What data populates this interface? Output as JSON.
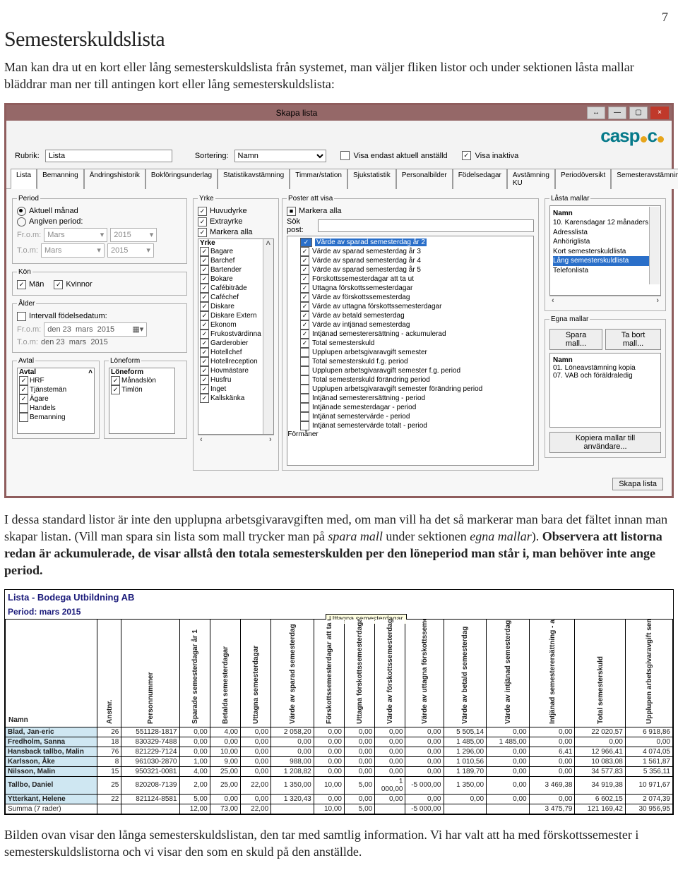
{
  "page_number": "7",
  "doc": {
    "heading": "Semesterskuldslista",
    "intro": "Man kan dra ut en kort eller lång semesterskuldslista från systemet, man väljer fliken listor och under sektionen låsta mallar bläddrar man ner till antingen kort eller lång semesterskuldslista:",
    "mid_a": "I dessa standard listor är inte den upplupna arbetsgivaravgiften med, om man vill ha det så markerar man bara det fältet innan man skapar listan. (Vill man spara sin lista som mall trycker man på ",
    "mid_em1": "spara mall",
    "mid_b": " under sektionen ",
    "mid_em2": "egna mallar",
    "mid_c": "). ",
    "mid_strong": "Observera att listorna redan är ackumulerade, de visar allstå den totala semesterskulden per den löneperiod man står i, man behöver inte ange period.",
    "bottom": "Bilden ovan visar den långa semesterskuldslistan, den tar med samtlig information. Vi har valt att ha med förskottssemester i semesterskuldslistorna och vi visar den som en skuld på den anställde."
  },
  "dialog": {
    "title": "Skapa lista",
    "logo": "caspeco",
    "rubrik_label": "Rubrik:",
    "rubrik_value": "Lista",
    "sortering_label": "Sortering:",
    "sortering_value": "Namn",
    "chk_aktuell": "Visa endast aktuell anställd",
    "chk_inaktiva": "Visa inaktiva",
    "tabs": [
      "Lista",
      "Bemanning",
      "Ändringshistorik",
      "Bokföringsunderlag",
      "Statistikavstämning",
      "Timmar/station",
      "Sjukstatistik",
      "Personalbilder",
      "Födelsedagar",
      "Avstämning KU",
      "Periodöversikt",
      "Semesteravstämning"
    ],
    "period": {
      "legend": "Period",
      "opt_aktuell": "Aktuell månad",
      "opt_angiven": "Angiven period:",
      "from_label": "Fr.o.m:",
      "to_label": "T.o.m:",
      "month": "Mars",
      "year": "2015"
    },
    "kon": {
      "legend": "Kön",
      "man": "Män",
      "kvinnor": "Kvinnor"
    },
    "alder": {
      "legend": "Ålder",
      "intervall": "Intervall födelsedatum:",
      "from_label": "Fr.o.m:",
      "to_label": "T.o.m:",
      "day": "den 23",
      "month": "mars",
      "year": "2015"
    },
    "avtal": {
      "legend": "Avtal",
      "header": "Avtal",
      "items": [
        "HRF",
        "Tjänstemän",
        "Ägare",
        "Handels",
        "Bemanning"
      ]
    },
    "loneform": {
      "legend": "Löneform",
      "header": "Löneform",
      "items": [
        "Månadslön",
        "Timlön"
      ]
    },
    "yrke": {
      "legend": "Yrke",
      "huvud": "Huvudyrke",
      "extra": "Extrayrke",
      "markall": "Markera alla",
      "listhead": "Yrke",
      "items": [
        "Bagare",
        "Barchef",
        "Bartender",
        "Bokare",
        "Cafébiträde",
        "Caféchef",
        "Diskare",
        "Diskare Extern",
        "Ekonom",
        "Frukostvärdinna",
        "Garderobier",
        "Hotellchef",
        "Hotellreception",
        "Hovmästare",
        "Husfru",
        "Inget",
        "Kallskänka"
      ]
    },
    "poster": {
      "legend": "Poster att visa",
      "markall": "Markera alla",
      "sok": "Sök post:",
      "selected": "Värde av sparad semesterdag år 2",
      "items_checked": [
        "Värde av sparad semesterdag år 3",
        "Värde av sparad semesterdag år 4",
        "Värde av sparad semesterdag år 5",
        "Förskottssemesterdagar att ta ut",
        "Uttagna förskottssemesterdagar",
        "Värde av förskottssemesterdag",
        "Värde av uttagna förskottssemesterdagar",
        "Värde av betald semesterdag",
        "Värde av intjänad semesterdag",
        "Intjänad semesterersättning - ackumulerad",
        "Total semesterskuld"
      ],
      "items_unchecked": [
        "Upplupen arbetsgivaravgift semester",
        "Total semesterskuld f.g. period",
        "Upplupen arbetsgivaravgift semester f.g. period",
        "Total semesterskuld förändring period",
        "Upplupen arbetsgivaravgift semester förändring period",
        "Intjänad semesterersättning - period",
        "Intjänade semesterdagar - period",
        "Intjänat semestervärde - period",
        "Intjänat semestervärde totalt - period"
      ],
      "branch": "Förmåner"
    },
    "lasta": {
      "legend": "Låsta mallar",
      "header": "Namn",
      "items": [
        "10. Karensdagar 12 månaders",
        "Adresslista",
        "Anhöriglista",
        "Kort semesterskuldlista",
        "Lång semesterskuldlista",
        "Telefonlista"
      ],
      "selected": "Lång semesterskuldlista"
    },
    "egna": {
      "legend": "Egna mallar",
      "spara": "Spara mall...",
      "tabort": "Ta bort mall...",
      "header": "Namn",
      "items": [
        "01. Löneavstämning kopia",
        "07. VAB och föräldraledig"
      ],
      "copy": "Kopiera mallar till användare..."
    },
    "skapa": "Skapa lista"
  },
  "table2": {
    "title": "Lista - Bodega Utbildning AB",
    "period": "Period: mars 2015",
    "tooltip": "Uttagna semesterdagar",
    "cols": [
      "Namn",
      "Anstnr.",
      "Personnummer",
      "Sparade semesterdagar år 1",
      "Betalda semesterdagar",
      "Uttagna semesterdagar",
      "Värde av sparad semesterdag",
      "Förskottssemesterdagar att ta ut",
      "Uttagna förskottssemesterdagar",
      "Värde av förskottssemesterdag",
      "Värde av uttagna förskottssemesterdagar",
      "Värde av betald semesterdag",
      "Värde av intjänad semesterdag",
      "Intjänad semesterersättning - ackumulerad",
      "Total semesterskuld",
      "Upplupen arbetsgivaravgift semester"
    ],
    "rows": [
      {
        "name": "Blad, Jan-eric",
        "c": [
          "26",
          "551128-1817",
          "0,00",
          "4,00",
          "0,00",
          "2 058,20",
          "0,00",
          "0,00",
          "0,00",
          "0,00",
          "5 505,14",
          "0,00",
          "0,00",
          "22 020,57",
          "6 918,86"
        ]
      },
      {
        "name": "Fredholm, Sanna",
        "c": [
          "18",
          "830329-7488",
          "0,00",
          "0,00",
          "0,00",
          "0,00",
          "0,00",
          "0,00",
          "0,00",
          "0,00",
          "1 485,00",
          "1 485,00",
          "0,00",
          "0,00",
          "0,00"
        ]
      },
      {
        "name": "Hansback tallbo, Malin",
        "c": [
          "76",
          "821229-7124",
          "0,00",
          "10,00",
          "0,00",
          "0,00",
          "0,00",
          "0,00",
          "0,00",
          "0,00",
          "1 296,00",
          "0,00",
          "6,41",
          "12 966,41",
          "4 074,05"
        ]
      },
      {
        "name": "Karlsson, Åke",
        "c": [
          "8",
          "961030-2870",
          "1,00",
          "9,00",
          "0,00",
          "988,00",
          "0,00",
          "0,00",
          "0,00",
          "0,00",
          "1 010,56",
          "0,00",
          "0,00",
          "10 083,08",
          "1 561,87"
        ]
      },
      {
        "name": "Nilsson, Malin",
        "c": [
          "15",
          "950321-0081",
          "4,00",
          "25,00",
          "0,00",
          "1 208,82",
          "0,00",
          "0,00",
          "0,00",
          "0,00",
          "1 189,70",
          "0,00",
          "0,00",
          "34 577,83",
          "5 356,11"
        ]
      },
      {
        "name": "Tallbo, Daniel",
        "c": [
          "25",
          "820208-7139",
          "2,00",
          "25,00",
          "22,00",
          "1 350,00",
          "10,00",
          "5,00",
          "1 000,00",
          "-5 000,00",
          "1 350,00",
          "0,00",
          "3 469,38",
          "34 919,38",
          "10 971,67"
        ]
      },
      {
        "name": "Ytterkant, Helene",
        "c": [
          "22",
          "821124-8581",
          "5,00",
          "0,00",
          "0,00",
          "1 320,43",
          "0,00",
          "0,00",
          "0,00",
          "0,00",
          "0,00",
          "0,00",
          "0,00",
          "6 602,15",
          "2 074,39"
        ]
      }
    ],
    "sum": {
      "name": "Summa (7 rader)",
      "c": [
        "",
        "",
        "12,00",
        "73,00",
        "22,00",
        "",
        "10,00",
        "5,00",
        "",
        "-5 000,00",
        "",
        "",
        "3 475,79",
        "121 169,42",
        "30 956,95"
      ]
    }
  }
}
